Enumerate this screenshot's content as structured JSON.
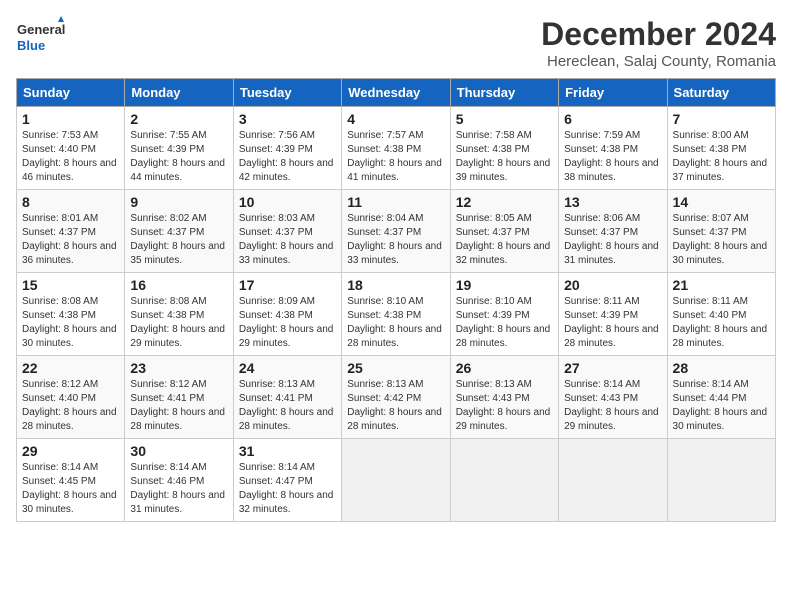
{
  "header": {
    "logo_line1": "General",
    "logo_line2": "Blue",
    "month": "December 2024",
    "location": "Hereclean, Salaj County, Romania"
  },
  "weekdays": [
    "Sunday",
    "Monday",
    "Tuesday",
    "Wednesday",
    "Thursday",
    "Friday",
    "Saturday"
  ],
  "weeks": [
    [
      {
        "day": 1,
        "sunrise": "7:53 AM",
        "sunset": "4:40 PM",
        "daylight": "8 hours and 46 minutes."
      },
      {
        "day": 2,
        "sunrise": "7:55 AM",
        "sunset": "4:39 PM",
        "daylight": "8 hours and 44 minutes."
      },
      {
        "day": 3,
        "sunrise": "7:56 AM",
        "sunset": "4:39 PM",
        "daylight": "8 hours and 42 minutes."
      },
      {
        "day": 4,
        "sunrise": "7:57 AM",
        "sunset": "4:38 PM",
        "daylight": "8 hours and 41 minutes."
      },
      {
        "day": 5,
        "sunrise": "7:58 AM",
        "sunset": "4:38 PM",
        "daylight": "8 hours and 39 minutes."
      },
      {
        "day": 6,
        "sunrise": "7:59 AM",
        "sunset": "4:38 PM",
        "daylight": "8 hours and 38 minutes."
      },
      {
        "day": 7,
        "sunrise": "8:00 AM",
        "sunset": "4:38 PM",
        "daylight": "8 hours and 37 minutes."
      }
    ],
    [
      {
        "day": 8,
        "sunrise": "8:01 AM",
        "sunset": "4:37 PM",
        "daylight": "8 hours and 36 minutes."
      },
      {
        "day": 9,
        "sunrise": "8:02 AM",
        "sunset": "4:37 PM",
        "daylight": "8 hours and 35 minutes."
      },
      {
        "day": 10,
        "sunrise": "8:03 AM",
        "sunset": "4:37 PM",
        "daylight": "8 hours and 33 minutes."
      },
      {
        "day": 11,
        "sunrise": "8:04 AM",
        "sunset": "4:37 PM",
        "daylight": "8 hours and 33 minutes."
      },
      {
        "day": 12,
        "sunrise": "8:05 AM",
        "sunset": "4:37 PM",
        "daylight": "8 hours and 32 minutes."
      },
      {
        "day": 13,
        "sunrise": "8:06 AM",
        "sunset": "4:37 PM",
        "daylight": "8 hours and 31 minutes."
      },
      {
        "day": 14,
        "sunrise": "8:07 AM",
        "sunset": "4:37 PM",
        "daylight": "8 hours and 30 minutes."
      }
    ],
    [
      {
        "day": 15,
        "sunrise": "8:08 AM",
        "sunset": "4:38 PM",
        "daylight": "8 hours and 30 minutes."
      },
      {
        "day": 16,
        "sunrise": "8:08 AM",
        "sunset": "4:38 PM",
        "daylight": "8 hours and 29 minutes."
      },
      {
        "day": 17,
        "sunrise": "8:09 AM",
        "sunset": "4:38 PM",
        "daylight": "8 hours and 29 minutes."
      },
      {
        "day": 18,
        "sunrise": "8:10 AM",
        "sunset": "4:38 PM",
        "daylight": "8 hours and 28 minutes."
      },
      {
        "day": 19,
        "sunrise": "8:10 AM",
        "sunset": "4:39 PM",
        "daylight": "8 hours and 28 minutes."
      },
      {
        "day": 20,
        "sunrise": "8:11 AM",
        "sunset": "4:39 PM",
        "daylight": "8 hours and 28 minutes."
      },
      {
        "day": 21,
        "sunrise": "8:11 AM",
        "sunset": "4:40 PM",
        "daylight": "8 hours and 28 minutes."
      }
    ],
    [
      {
        "day": 22,
        "sunrise": "8:12 AM",
        "sunset": "4:40 PM",
        "daylight": "8 hours and 28 minutes."
      },
      {
        "day": 23,
        "sunrise": "8:12 AM",
        "sunset": "4:41 PM",
        "daylight": "8 hours and 28 minutes."
      },
      {
        "day": 24,
        "sunrise": "8:13 AM",
        "sunset": "4:41 PM",
        "daylight": "8 hours and 28 minutes."
      },
      {
        "day": 25,
        "sunrise": "8:13 AM",
        "sunset": "4:42 PM",
        "daylight": "8 hours and 28 minutes."
      },
      {
        "day": 26,
        "sunrise": "8:13 AM",
        "sunset": "4:43 PM",
        "daylight": "8 hours and 29 minutes."
      },
      {
        "day": 27,
        "sunrise": "8:14 AM",
        "sunset": "4:43 PM",
        "daylight": "8 hours and 29 minutes."
      },
      {
        "day": 28,
        "sunrise": "8:14 AM",
        "sunset": "4:44 PM",
        "daylight": "8 hours and 30 minutes."
      }
    ],
    [
      {
        "day": 29,
        "sunrise": "8:14 AM",
        "sunset": "4:45 PM",
        "daylight": "8 hours and 30 minutes."
      },
      {
        "day": 30,
        "sunrise": "8:14 AM",
        "sunset": "4:46 PM",
        "daylight": "8 hours and 31 minutes."
      },
      {
        "day": 31,
        "sunrise": "8:14 AM",
        "sunset": "4:47 PM",
        "daylight": "8 hours and 32 minutes."
      },
      null,
      null,
      null,
      null
    ]
  ]
}
